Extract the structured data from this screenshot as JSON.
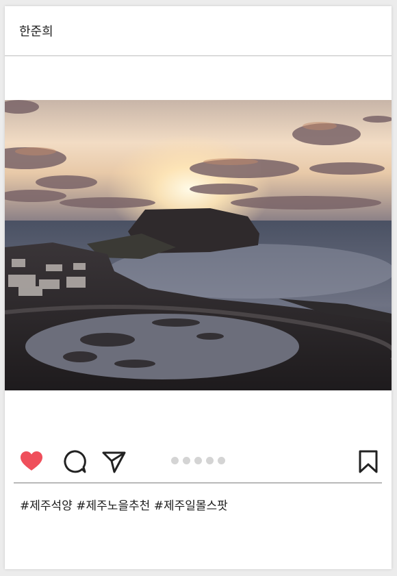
{
  "post": {
    "username": "한준희",
    "hashtags": "#제주석양 #제주노을추천 #제주일몰스팟",
    "carousel": {
      "count": 5,
      "active_index": 0
    },
    "liked": true
  },
  "colors": {
    "like": "#ef4f5b",
    "icon": "#222222",
    "dot": "#d4d4d4"
  },
  "icons": [
    "heart-icon",
    "comment-icon",
    "share-icon",
    "bookmark-icon"
  ]
}
